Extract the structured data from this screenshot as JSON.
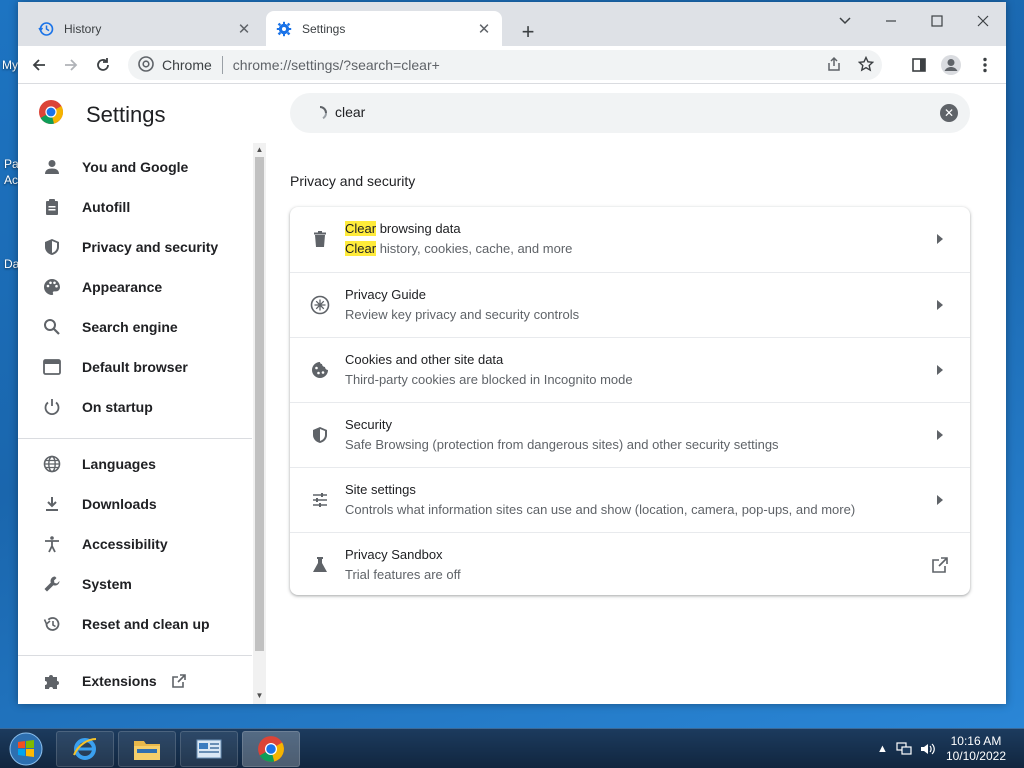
{
  "desktop": {
    "labels": [
      "My",
      "Pa",
      "Ac",
      "Da"
    ]
  },
  "tabs": [
    {
      "title": "History",
      "icon": "history-icon"
    },
    {
      "title": "Settings",
      "icon": "gear-icon"
    }
  ],
  "toolbar": {
    "site_chip": "Chrome",
    "url": "chrome://settings/?search=clear+"
  },
  "settings": {
    "title": "Settings",
    "search_value": "clear"
  },
  "sidebar": {
    "items": [
      {
        "label": "You and Google",
        "icon": "person-icon"
      },
      {
        "label": "Autofill",
        "icon": "clipboard-icon"
      },
      {
        "label": "Privacy and security",
        "icon": "shield-icon"
      },
      {
        "label": "Appearance",
        "icon": "palette-icon"
      },
      {
        "label": "Search engine",
        "icon": "search-icon"
      },
      {
        "label": "Default browser",
        "icon": "browser-icon"
      },
      {
        "label": "On startup",
        "icon": "power-icon"
      },
      {
        "label": "Languages",
        "icon": "globe-icon"
      },
      {
        "label": "Downloads",
        "icon": "download-icon"
      },
      {
        "label": "Accessibility",
        "icon": "accessibility-icon"
      },
      {
        "label": "System",
        "icon": "wrench-icon"
      },
      {
        "label": "Reset and clean up",
        "icon": "restore-icon"
      },
      {
        "label": "Extensions",
        "icon": "puzzle-icon"
      }
    ]
  },
  "main": {
    "section_title": "Privacy and security",
    "rows": [
      {
        "title_highlight": "Clear",
        "title_rest": " browsing data",
        "sub_highlight": "Clear",
        "sub_rest": " history, cookies, cache, and more",
        "icon": "trash-icon"
      },
      {
        "title": "Privacy Guide",
        "sub": "Review key privacy and security controls",
        "icon": "compass-icon"
      },
      {
        "title": "Cookies and other site data",
        "sub": "Third-party cookies are blocked in Incognito mode",
        "icon": "cookie-icon"
      },
      {
        "title": "Security",
        "sub": "Safe Browsing (protection from dangerous sites) and other security settings",
        "icon": "shield-icon"
      },
      {
        "title": "Site settings",
        "sub": "Controls what information sites can use and show (location, camera, pop-ups, and more)",
        "icon": "sliders-icon"
      },
      {
        "title": "Privacy Sandbox",
        "sub": "Trial features are off",
        "icon": "flask-icon"
      }
    ]
  },
  "taskbar": {
    "time": "10:16 AM",
    "date": "10/10/2022"
  },
  "colors": {
    "highlight": "#ffeb3b",
    "accent": "#1a73e8"
  }
}
